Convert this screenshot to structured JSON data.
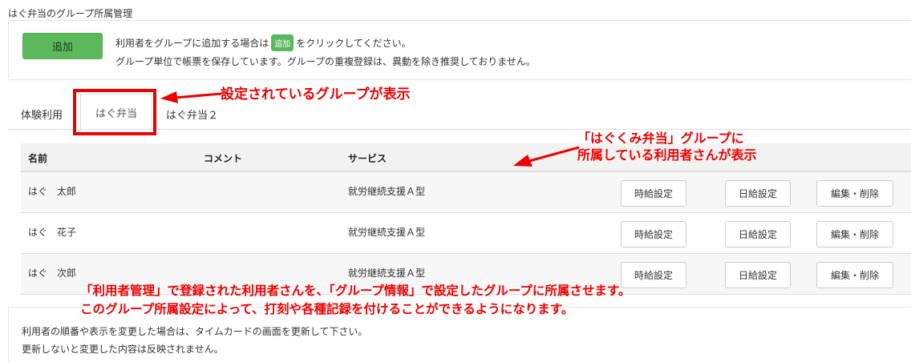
{
  "page": {
    "title": "はぐ弁当のグループ所属管理"
  },
  "add_panel": {
    "add_button": "追加",
    "info_prefix": "利用者をグループに追加する場合は",
    "info_inline_button": "追加",
    "info_suffix": "をクリックしてください。",
    "info_line2": "グループ単位で帳票を保存しています。グループの重複登録は、異動を除き推奨しておりません。"
  },
  "tabs": [
    {
      "label": "体験利用"
    },
    {
      "label": "はぐ弁当",
      "active": true
    },
    {
      "label": "はぐ弁当２"
    }
  ],
  "table": {
    "headers": {
      "name": "名前",
      "comment": "コメント",
      "service": "サービス"
    },
    "rows": [
      {
        "name": "はぐ　太郎",
        "comment": "",
        "service": "就労継続支援Ａ型"
      },
      {
        "name": "はぐ　花子",
        "comment": "",
        "service": "就労継続支援Ａ型"
      },
      {
        "name": "はぐ　次郎",
        "comment": "",
        "service": "就労継続支援Ａ型"
      }
    ],
    "row_buttons": {
      "hourly": "時給設定",
      "daily": "日給設定",
      "edit": "編集・削除"
    }
  },
  "notes": {
    "line1": "利用者の順番や表示を変更した場合は、タイムカードの画面を更新して下さい。",
    "line2": "更新しないと変更した内容は反映されません。"
  },
  "annotations": {
    "tab_note": "設定されているグループが表示",
    "table_note_line1": "「はぐくみ弁当」グループに",
    "table_note_line2": "所属している利用者さんが表示",
    "bottom_line1": "「利用者管理」で登録された利用者さんを、「グループ情報」で設定したグループに所属させます。",
    "bottom_line2": "このグループ所属設定によって、打刻や各種記録を付けることができるようになります。"
  },
  "colors": {
    "primary_green": "#5cb85c",
    "annotation_red": "#e00000"
  }
}
